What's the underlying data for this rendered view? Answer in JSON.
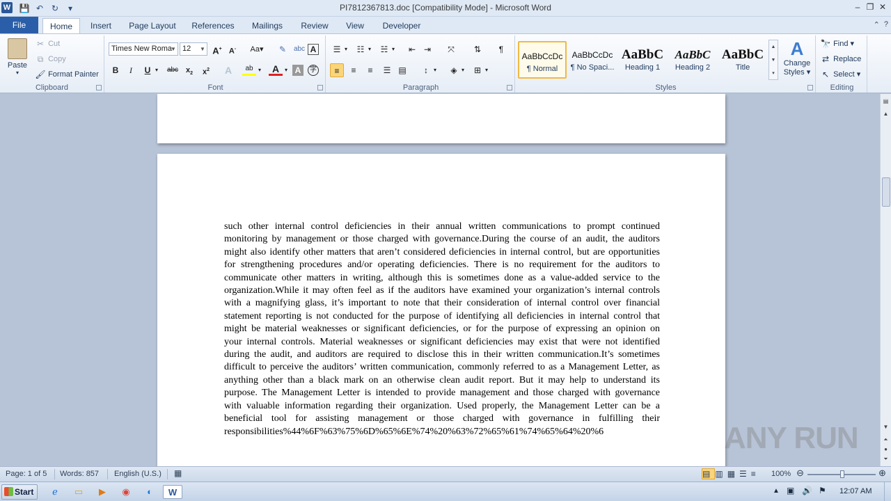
{
  "window": {
    "title": "PI7812367813.doc [Compatibility Mode]  -  Microsoft Word",
    "app_icon": "W"
  },
  "tabs": [
    {
      "label": "File"
    },
    {
      "label": "Home"
    },
    {
      "label": "Insert"
    },
    {
      "label": "Page Layout"
    },
    {
      "label": "References"
    },
    {
      "label": "Mailings"
    },
    {
      "label": "Review"
    },
    {
      "label": "View"
    },
    {
      "label": "Developer"
    }
  ],
  "clipboard": {
    "paste": "Paste",
    "cut": "Cut",
    "copy": "Copy",
    "format_painter": "Format Painter",
    "label": "Clipboard"
  },
  "font": {
    "name": "Times New Roma",
    "size": "12",
    "label": "Font"
  },
  "paragraph": {
    "label": "Paragraph"
  },
  "styles": {
    "items": [
      {
        "sample": "AaBbCcDc",
        "name": "¶ Normal"
      },
      {
        "sample": "AaBbCcDc",
        "name": "¶ No Spaci..."
      },
      {
        "sample": "AaBbC",
        "name": "Heading 1"
      },
      {
        "sample": "AaBbC",
        "name": "Heading 2"
      },
      {
        "sample": "AaBbC",
        "name": "Title"
      }
    ],
    "change_styles": [
      "Change",
      "Styles"
    ],
    "label": "Styles"
  },
  "editing": {
    "find": "Find",
    "replace": "Replace",
    "select": "Select",
    "label": "Editing"
  },
  "document": {
    "body": "such other internal control deficiencies in their annual written communications to prompt continued monitoring by management or those charged with governance.During the course of an audit, the auditors might also identify other matters that aren’t considered deficiencies in internal control, but are opportunities for strengthening procedures and/or operating deficiencies. There is no requirement for the auditors to communicate other matters in writing, although this is sometimes done as a value-added service to the organization.While it may often feel as if the auditors have examined your organization’s internal controls with a magnifying glass, it’s important to note that their consideration of internal control over financial statement reporting is not conducted for the purpose of identifying all deficiencies in internal control that might be material weaknesses or significant deficiencies, or for the purpose of expressing an opinion on your internal controls. Material weaknesses or significant deficiencies may exist that were not identified during the audit, and auditors are required to disclose this in their written communication.It’s sometimes difficult to perceive the auditors’ written communication, commonly referred to as a Management Letter, as anything other than a black mark on an otherwise clean audit report. But it may help to understand its purpose. The Management Letter is intended to provide management and those charged with governance with valuable information regarding their organization. Used properly, the Management Letter can be a beneficial tool for assisting management or those charged with governance in fulfilling their responsibilities%44%6F%63%75%6D%65%6E%74%20%63%72%65%61%74%65%64%20%6"
  },
  "status": {
    "page": "Page: 1 of 5",
    "words": "Words: 857",
    "language": "English (U.S.)",
    "zoom": "100%"
  },
  "taskbar": {
    "start": "Start",
    "clock": "12:07 AM"
  },
  "watermark": "ANY RUN"
}
